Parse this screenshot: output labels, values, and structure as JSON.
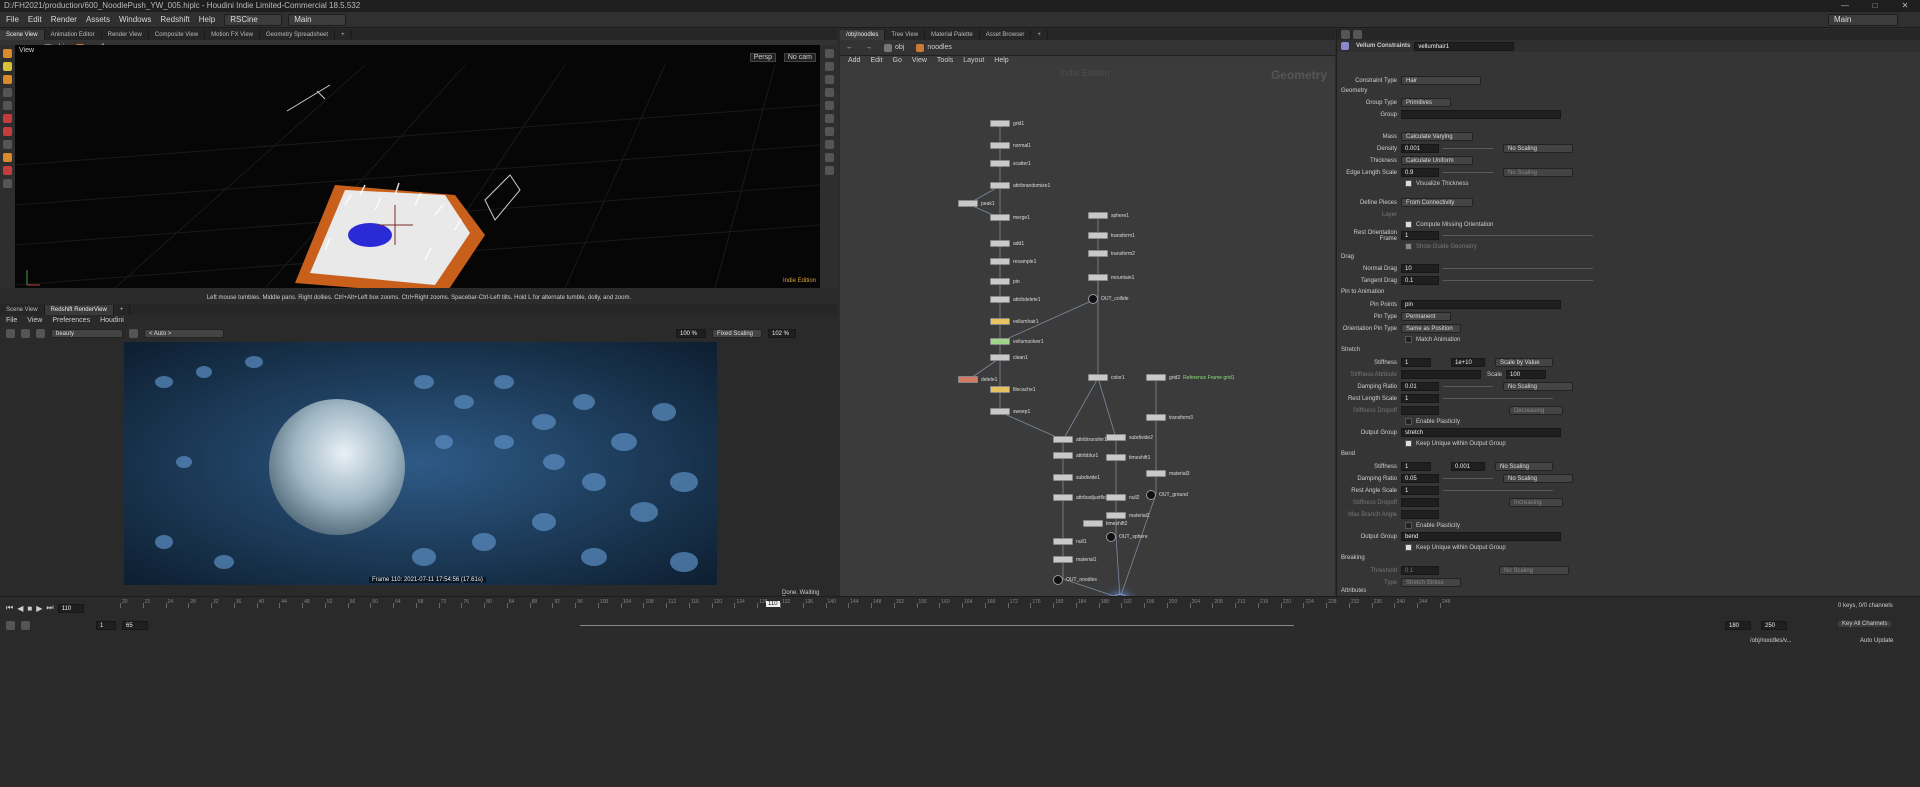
{
  "window": {
    "title": "D:/FH2021/production/600_NoodlePush_YW_005.hiplc - Houdini Indie Limited-Commercial 18.5.532"
  },
  "menubar": {
    "items": [
      "File",
      "Edit",
      "Render",
      "Assets",
      "Windows",
      "Redshift",
      "Help"
    ],
    "shelf_set": "RSCine",
    "desktop": "Main",
    "right_desktop": "Main"
  },
  "scene_panel": {
    "tabs": [
      "Scene View",
      "Animation Editor",
      "Render View",
      "Composite View",
      "Motion FX View",
      "Geometry Spreadsheet"
    ],
    "path": [
      "obj",
      "noodles"
    ],
    "view_label": "View",
    "persp": "Persp",
    "cam": "No cam",
    "hint": "Left mouse tumbles. Middle pans. Right dollies. Ctrl+Alt+Left box zooms. Ctrl+Right zooms. Spacebar-Ctrl-Left tilts. Hold L for alternate tumble, dolly, and zoom.",
    "edition": "Indie Edition"
  },
  "render_panel": {
    "tabs": [
      "Scene View",
      "Redshift RenderView"
    ],
    "menu": [
      "File",
      "View",
      "Preferences",
      "Houdini"
    ],
    "aov": "beauty",
    "auto": "< Auto >",
    "zoom": "100 %",
    "scaling": "Fixed Scaling",
    "scale_pct": "102 %",
    "frame_info": "Frame 110: 2021-07-11 17:54:56 (17.61s)",
    "status": "Done. Waiting Events"
  },
  "network_panel": {
    "tabs": [
      "/obj/noodles",
      "Tree View",
      "Material Palette",
      "Asset Browser"
    ],
    "path": [
      "obj",
      "noodles"
    ],
    "menu": [
      "Add",
      "Edit",
      "Go",
      "View",
      "Tools",
      "Layout",
      "Help"
    ],
    "watermark": "Indie Edition",
    "context": "Geometry",
    "nodes": [
      {
        "name": "grid1",
        "style": "n",
        "note": ""
      },
      {
        "name": "normal1",
        "style": "n",
        "note": ""
      },
      {
        "name": "scatter1",
        "style": "n",
        "note": ""
      },
      {
        "name": "attribrandomize1",
        "style": "n",
        "note": ""
      },
      {
        "name": "peak1",
        "style": "n",
        "note": ""
      },
      {
        "name": "merge1",
        "style": "n",
        "note": ""
      },
      {
        "name": "add1",
        "style": "n",
        "note": ""
      },
      {
        "name": "resample1",
        "style": "n",
        "note": ""
      },
      {
        "name": "pin",
        "style": "n",
        "note": ""
      },
      {
        "name": "attribdelete1",
        "style": "n",
        "note": ""
      },
      {
        "name": "vellumhair1",
        "style": "yel",
        "note": ""
      },
      {
        "name": "vellumsolver1",
        "style": "grn",
        "note": ""
      },
      {
        "name": "clean1",
        "style": "n",
        "note": ""
      },
      {
        "name": "delete1",
        "style": "red",
        "note": ""
      },
      {
        "name": "filecache1",
        "style": "yel",
        "note": ""
      },
      {
        "name": "sweep1",
        "style": "n",
        "note": ""
      },
      {
        "name": "attribtransfer1",
        "style": "n",
        "note": ""
      },
      {
        "name": "attribblur1",
        "style": "n",
        "note": ""
      },
      {
        "name": "subdivide1",
        "style": "n",
        "note": ""
      },
      {
        "name": "attribadjustfloat1",
        "style": "n",
        "note": ""
      },
      {
        "name": "null1",
        "style": "n",
        "note": ""
      },
      {
        "name": "material1",
        "style": "n",
        "note": ""
      },
      {
        "name": "OUT_noodles",
        "style": "blk",
        "note": ""
      },
      {
        "name": "sphere1",
        "style": "n",
        "note": ""
      },
      {
        "name": "transform1",
        "style": "n",
        "note": ""
      },
      {
        "name": "transform2",
        "style": "n",
        "note": ""
      },
      {
        "name": "mountain1",
        "style": "n",
        "note": ""
      },
      {
        "name": "OUT_collide",
        "style": "blk",
        "note": ""
      },
      {
        "name": "color1",
        "style": "n",
        "note": ""
      },
      {
        "name": "subdivide2",
        "style": "n",
        "note": ""
      },
      {
        "name": "timeshift1",
        "style": "n",
        "note": ""
      },
      {
        "name": "null2",
        "style": "n",
        "note": ""
      },
      {
        "name": "material2",
        "style": "n",
        "note": ""
      },
      {
        "name": "OUT_sphere",
        "style": "blk",
        "note": ""
      },
      {
        "name": "timeshift2",
        "style": "n",
        "note": ""
      },
      {
        "name": "grid2",
        "style": "n",
        "note": "Reference Frame grid1"
      },
      {
        "name": "transform3",
        "style": "n",
        "note": ""
      },
      {
        "name": "material3",
        "style": "n",
        "note": ""
      },
      {
        "name": "OUT_ground",
        "style": "blk",
        "note": ""
      },
      {
        "name": "merge2",
        "style": "blk",
        "note": ""
      }
    ]
  },
  "params": {
    "node_type": "Vellum Constraints",
    "node_name": "vellumhair1",
    "constraint_type_label": "Constraint Type",
    "constraint_type": "Hair",
    "geometry_section": "Geometry",
    "group_type_label": "Group Type",
    "group_type": "Primitives",
    "group_label": "Group",
    "mass_label": "Mass",
    "mass": "Calculate Varying",
    "density_label": "Density",
    "density": "0.001",
    "thickness_label": "Thickness",
    "thickness": "Calculate Uniform",
    "edge_length_label": "Edge Length Scale",
    "edge_length": "0.9",
    "no_scaling": "No Scaling",
    "visualize_thickness": "Visualize Thickness",
    "define_pieces_label": "Define Pieces",
    "define_pieces": "From Connectivity",
    "layer_label": "Layer",
    "compute_missing": "Compute Missing Orientation",
    "rest_orient_label": "Rest Orientation Frame",
    "rest_orient": "1",
    "show_guide": "Show Guide Geometry",
    "drag_section": "Drag",
    "normal_drag_label": "Normal Drag",
    "normal_drag": "10",
    "tangent_drag_label": "Tangent Drag",
    "tangent_drag": "0.1",
    "pin_section": "Pin to Animation",
    "pin_points_label": "Pin Points",
    "pin_points": "pin",
    "pin_type_label": "Pin Type",
    "pin_type": "Permanent",
    "orient_pin_label": "Orientation Pin Type",
    "orient_pin": "Same as Position",
    "match_anim": "Match Animation",
    "stretch_section": "Stretch",
    "stiffness_label": "Stiffness",
    "stretch_stiffness": "1",
    "stretch_exp": "1e+10",
    "scale_by_value": "Scale by Value",
    "stiffness_attr_label": "Stiffness Attribute",
    "scale_label": "Scale",
    "scale_value": "100",
    "damping_label": "Damping Ratio",
    "stretch_damping": "0.01",
    "rest_length_label": "Rest Length Scale",
    "rest_length": "1",
    "stiffness_dropoff_label": "Stiffness Dropoff",
    "decreasing": "Decreasing",
    "enable_plasticity": "Enable Plasticity",
    "output_group_label": "Output Group",
    "stretch_group": "stretch",
    "keep_unique": "Keep Unique within Output Group",
    "bend_section": "Bend",
    "bend_stiffness": "1",
    "bend_exp": "0.001",
    "bend_damping": "0.05",
    "rest_angle_label": "Rest Angle Scale",
    "rest_angle": "1",
    "increasing": "Increasing",
    "max_branch_label": "Max Branch Angle",
    "bend_group": "bend",
    "breaking_section": "Breaking",
    "threshold_label": "Threshold",
    "threshold": "0.1",
    "type_label": "Type",
    "stretch_stress": "Stretch Stress",
    "attributes_section": "Attributes"
  },
  "timeline": {
    "current_frame": "110",
    "frame_marker": "110",
    "start": "1",
    "range_start": "65",
    "end": "180",
    "range_end": "250",
    "ticks": [
      "20",
      "21",
      "24",
      "28",
      "32",
      "36",
      "40",
      "44",
      "48",
      "52",
      "56",
      "60",
      "64",
      "68",
      "72",
      "76",
      "80",
      "84",
      "88",
      "92",
      "96",
      "100",
      "104",
      "108",
      "112",
      "116",
      "120",
      "124",
      "128",
      "132",
      "136",
      "140",
      "144",
      "148",
      "152",
      "156",
      "160",
      "164",
      "168",
      "172",
      "176",
      "180",
      "184",
      "188",
      "192",
      "196",
      "200",
      "204",
      "208",
      "212",
      "216",
      "220",
      "224",
      "228",
      "232",
      "236",
      "240",
      "244",
      "248"
    ],
    "keys": "0 keys, 0/0 channels",
    "key_all": "Key All Channels",
    "path_status": "/obj/noodles/v...",
    "auto_update": "Auto Update"
  }
}
